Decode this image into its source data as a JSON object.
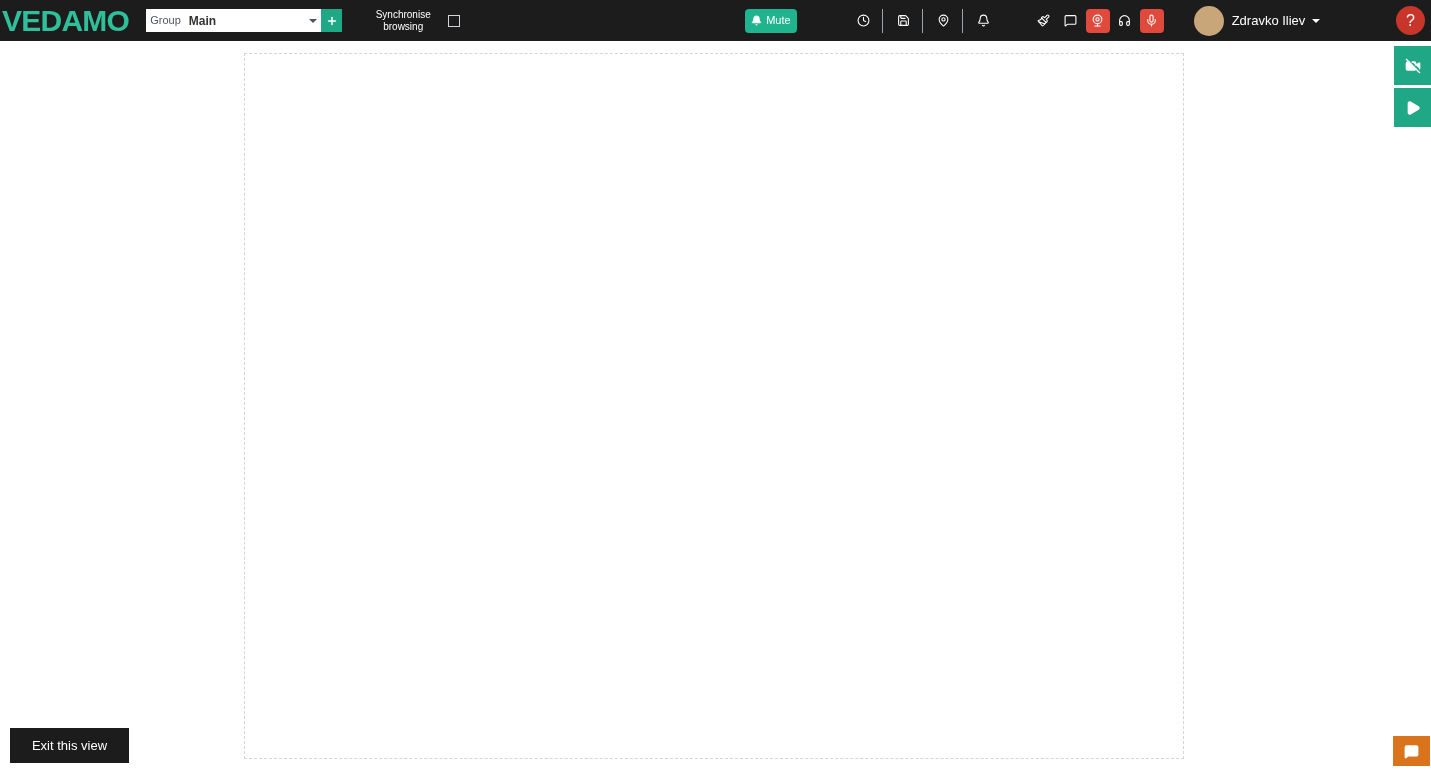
{
  "logo": "VEDAMO",
  "group_select": {
    "label": "Group",
    "value": "Main"
  },
  "sync": {
    "label": "Synchronise browsing",
    "checked": false
  },
  "mute_button": {
    "label": "Mute"
  },
  "tools": [
    {
      "kind": "clock",
      "active": false
    },
    {
      "kind": "save",
      "active": false
    },
    {
      "kind": "location",
      "active": false
    },
    {
      "kind": "bell",
      "active": false
    },
    {
      "kind": "brush",
      "active": false
    },
    {
      "kind": "chat",
      "active": false
    },
    {
      "kind": "webcam",
      "active": true
    },
    {
      "kind": "headphones",
      "active": false
    },
    {
      "kind": "mic",
      "active": true
    }
  ],
  "user": {
    "name": "Zdravko Iliev"
  },
  "help": "?",
  "side_buttons": [
    {
      "kind": "video-off"
    },
    {
      "kind": "play"
    }
  ],
  "exit_button": "Exit this view"
}
